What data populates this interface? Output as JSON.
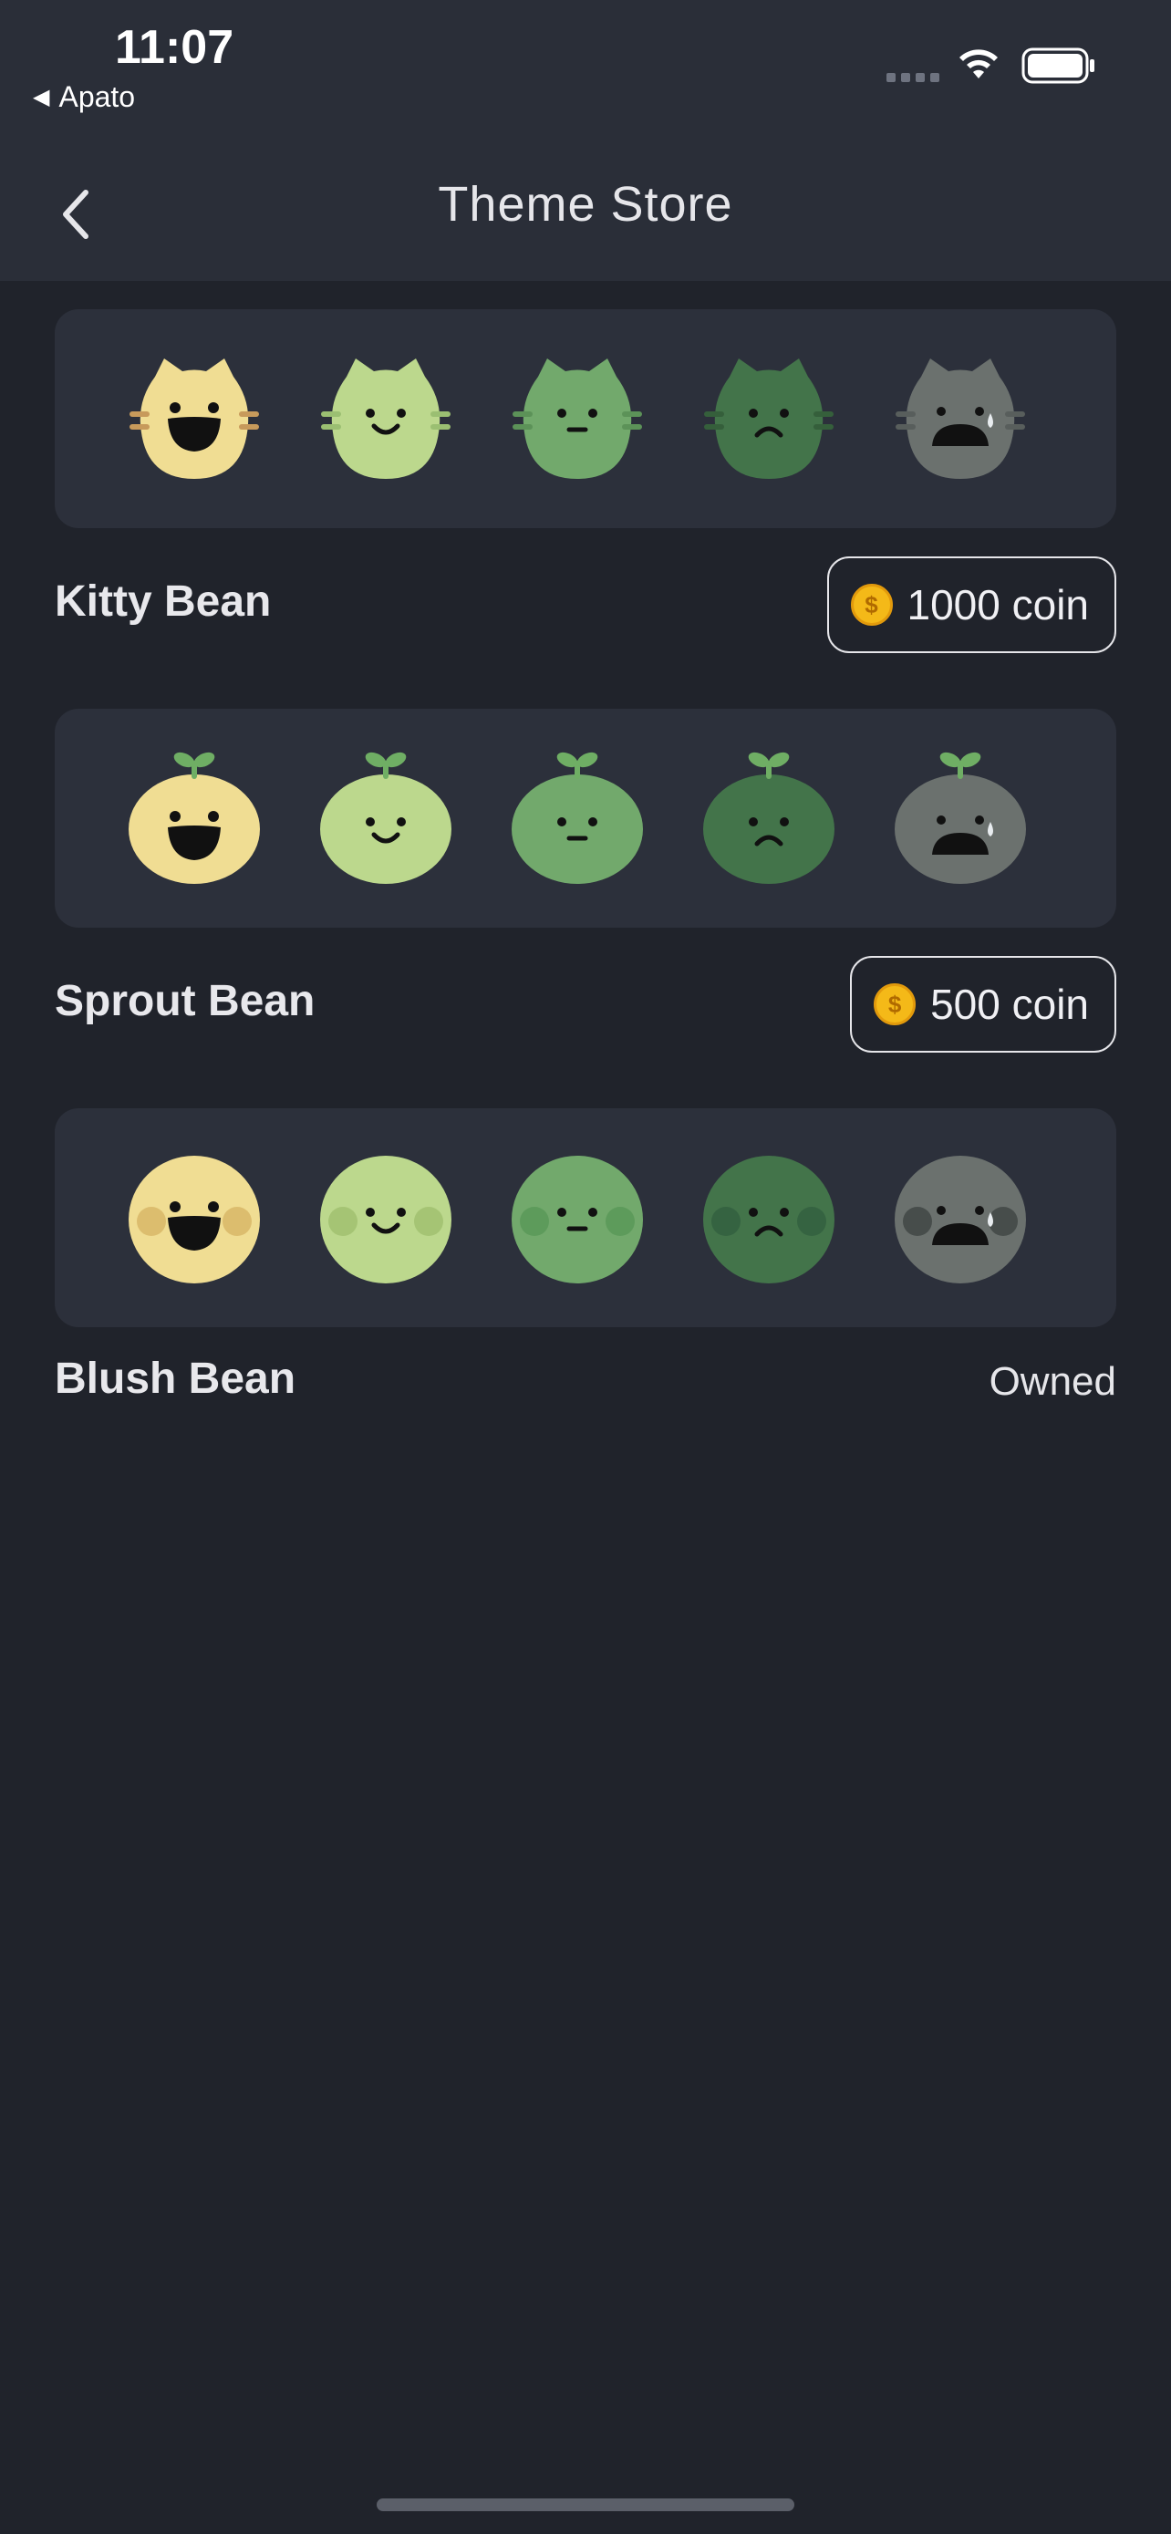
{
  "status_bar": {
    "time": "11:07",
    "back_app": "Apato",
    "back_arrow": "◀"
  },
  "nav": {
    "title": "Theme Store",
    "back_icon": "chevron-left-icon"
  },
  "themes": [
    {
      "name": "Kitty Bean",
      "style": "kitty",
      "price_label": "1000 coin",
      "owned": false
    },
    {
      "name": "Sprout Bean",
      "style": "sprout",
      "price_label": "500 coin",
      "owned": false
    },
    {
      "name": "Blush Bean",
      "style": "blush",
      "status_label": "Owned",
      "owned": true
    }
  ],
  "mood_colors": [
    "#f0dd93",
    "#bcd88d",
    "#72a96c",
    "#43744a",
    "#6b716e"
  ],
  "colors": {
    "background": "#20232b",
    "header": "#2a2e38",
    "card": "#2c303b",
    "coin": "#f4b918"
  }
}
